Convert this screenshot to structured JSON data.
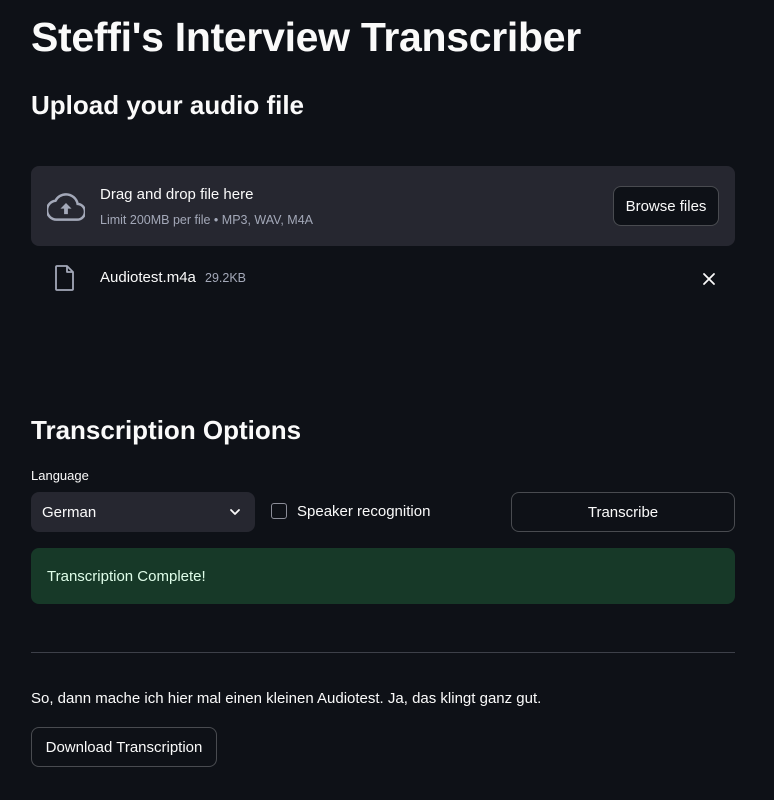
{
  "header": {
    "title": "Steffi's Interview Transcriber"
  },
  "upload": {
    "heading": "Upload your audio file",
    "dropzone_title": "Drag and drop file here",
    "dropzone_limit": "Limit 200MB per file • MP3, WAV, M4A",
    "browse_label": "Browse files",
    "file": {
      "name": "Audiotest.m4a",
      "size": "29.2KB"
    }
  },
  "options": {
    "heading": "Transcription Options",
    "language_label": "Language",
    "language_value": "German",
    "speaker_label": "Speaker recognition",
    "speaker_checked": false,
    "transcribe_label": "Transcribe"
  },
  "status": {
    "message": "Transcription Complete!",
    "color": "#173928"
  },
  "result": {
    "transcript": "So, dann mache ich hier mal einen kleinen Audiotest. Ja, das klingt ganz gut.",
    "download_label": "Download Transcription"
  },
  "icons": {
    "upload": "cloud-upload-icon",
    "file": "file-icon",
    "remove": "close-icon",
    "dropdown": "chevron-down-icon"
  },
  "colors": {
    "background": "#0e1117",
    "surface": "#262730",
    "text": "#fafafa",
    "muted": "#a3a8b8"
  }
}
